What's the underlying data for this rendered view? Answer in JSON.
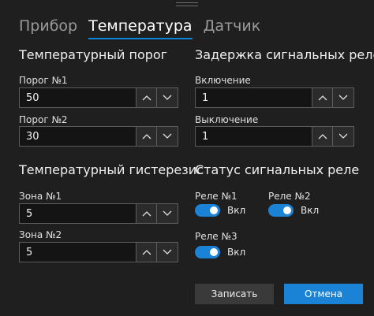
{
  "tabs": [
    {
      "label": "Прибор",
      "active": false
    },
    {
      "label": "Температура",
      "active": true
    },
    {
      "label": "Датчик",
      "active": false
    }
  ],
  "temp_threshold": {
    "title": "Температурный порог",
    "fields": [
      {
        "label": "Порог №1",
        "value": "50"
      },
      {
        "label": "Порог №2",
        "value": "30"
      }
    ]
  },
  "relay_delay": {
    "title": "Задержка сигнальных реле",
    "fields": [
      {
        "label": "Включение",
        "value": "1"
      },
      {
        "label": "Выключение",
        "value": "1"
      }
    ]
  },
  "temp_hysteresis": {
    "title": "Температурный гистерезис",
    "fields": [
      {
        "label": "Зона №1",
        "value": "5"
      },
      {
        "label": "Зона №2",
        "value": "5"
      }
    ]
  },
  "relay_status": {
    "title": "Статус сигнальных реле",
    "relays": [
      {
        "label": "Реле №1",
        "state_text": "Вкл",
        "on": true
      },
      {
        "label": "Реле №2",
        "state_text": "Вкл",
        "on": true
      },
      {
        "label": "Реле №3",
        "state_text": "Вкл",
        "on": true
      }
    ]
  },
  "buttons": {
    "save": "Записать",
    "cancel": "Отмена"
  },
  "icons": {
    "up": "chevron-up-icon",
    "down": "chevron-down-icon"
  },
  "colors": {
    "accent": "#1a83d6",
    "background": "#1f1f1f",
    "input_bg": "#141414"
  }
}
